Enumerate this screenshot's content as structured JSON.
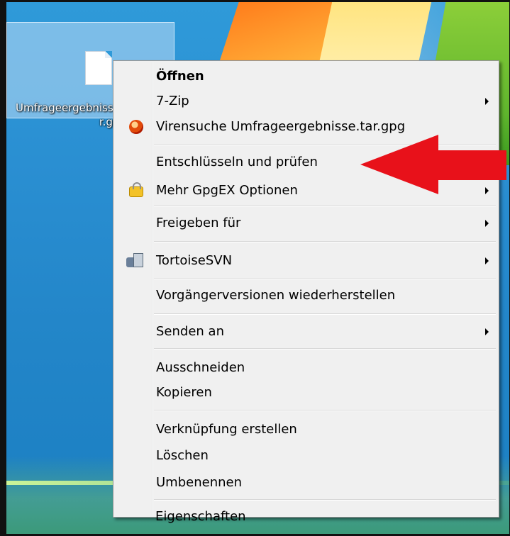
{
  "desktop": {
    "file": {
      "label_line1": "Umfrageergebnisse.ta",
      "label_line2": "r.gpg"
    }
  },
  "context_menu": {
    "items": [
      {
        "label": "Öffnen",
        "bold": true
      },
      {
        "label": "7-Zip",
        "submenu": true
      },
      {
        "label": "Virensuche Umfrageergebnisse.tar.gpg",
        "icon": "antivirus-icon"
      },
      {
        "label": "Entschlüsseln und prüfen"
      },
      {
        "label": "Mehr GpgEX Optionen",
        "icon": "lock-icon",
        "submenu": true
      },
      {
        "label": "Freigeben für",
        "submenu": true
      },
      {
        "label": "TortoiseSVN",
        "icon": "tortoisesvn-icon",
        "submenu": true
      },
      {
        "label": "Vorgängerversionen wiederherstellen"
      },
      {
        "label": "Senden an",
        "submenu": true
      },
      {
        "label": "Ausschneiden"
      },
      {
        "label": "Kopieren"
      },
      {
        "label": "Verknüpfung erstellen"
      },
      {
        "label": "Löschen"
      },
      {
        "label": "Umbenennen"
      },
      {
        "label": "Eigenschaften"
      }
    ]
  },
  "annotation": {
    "arrow_color": "#e8111a"
  }
}
